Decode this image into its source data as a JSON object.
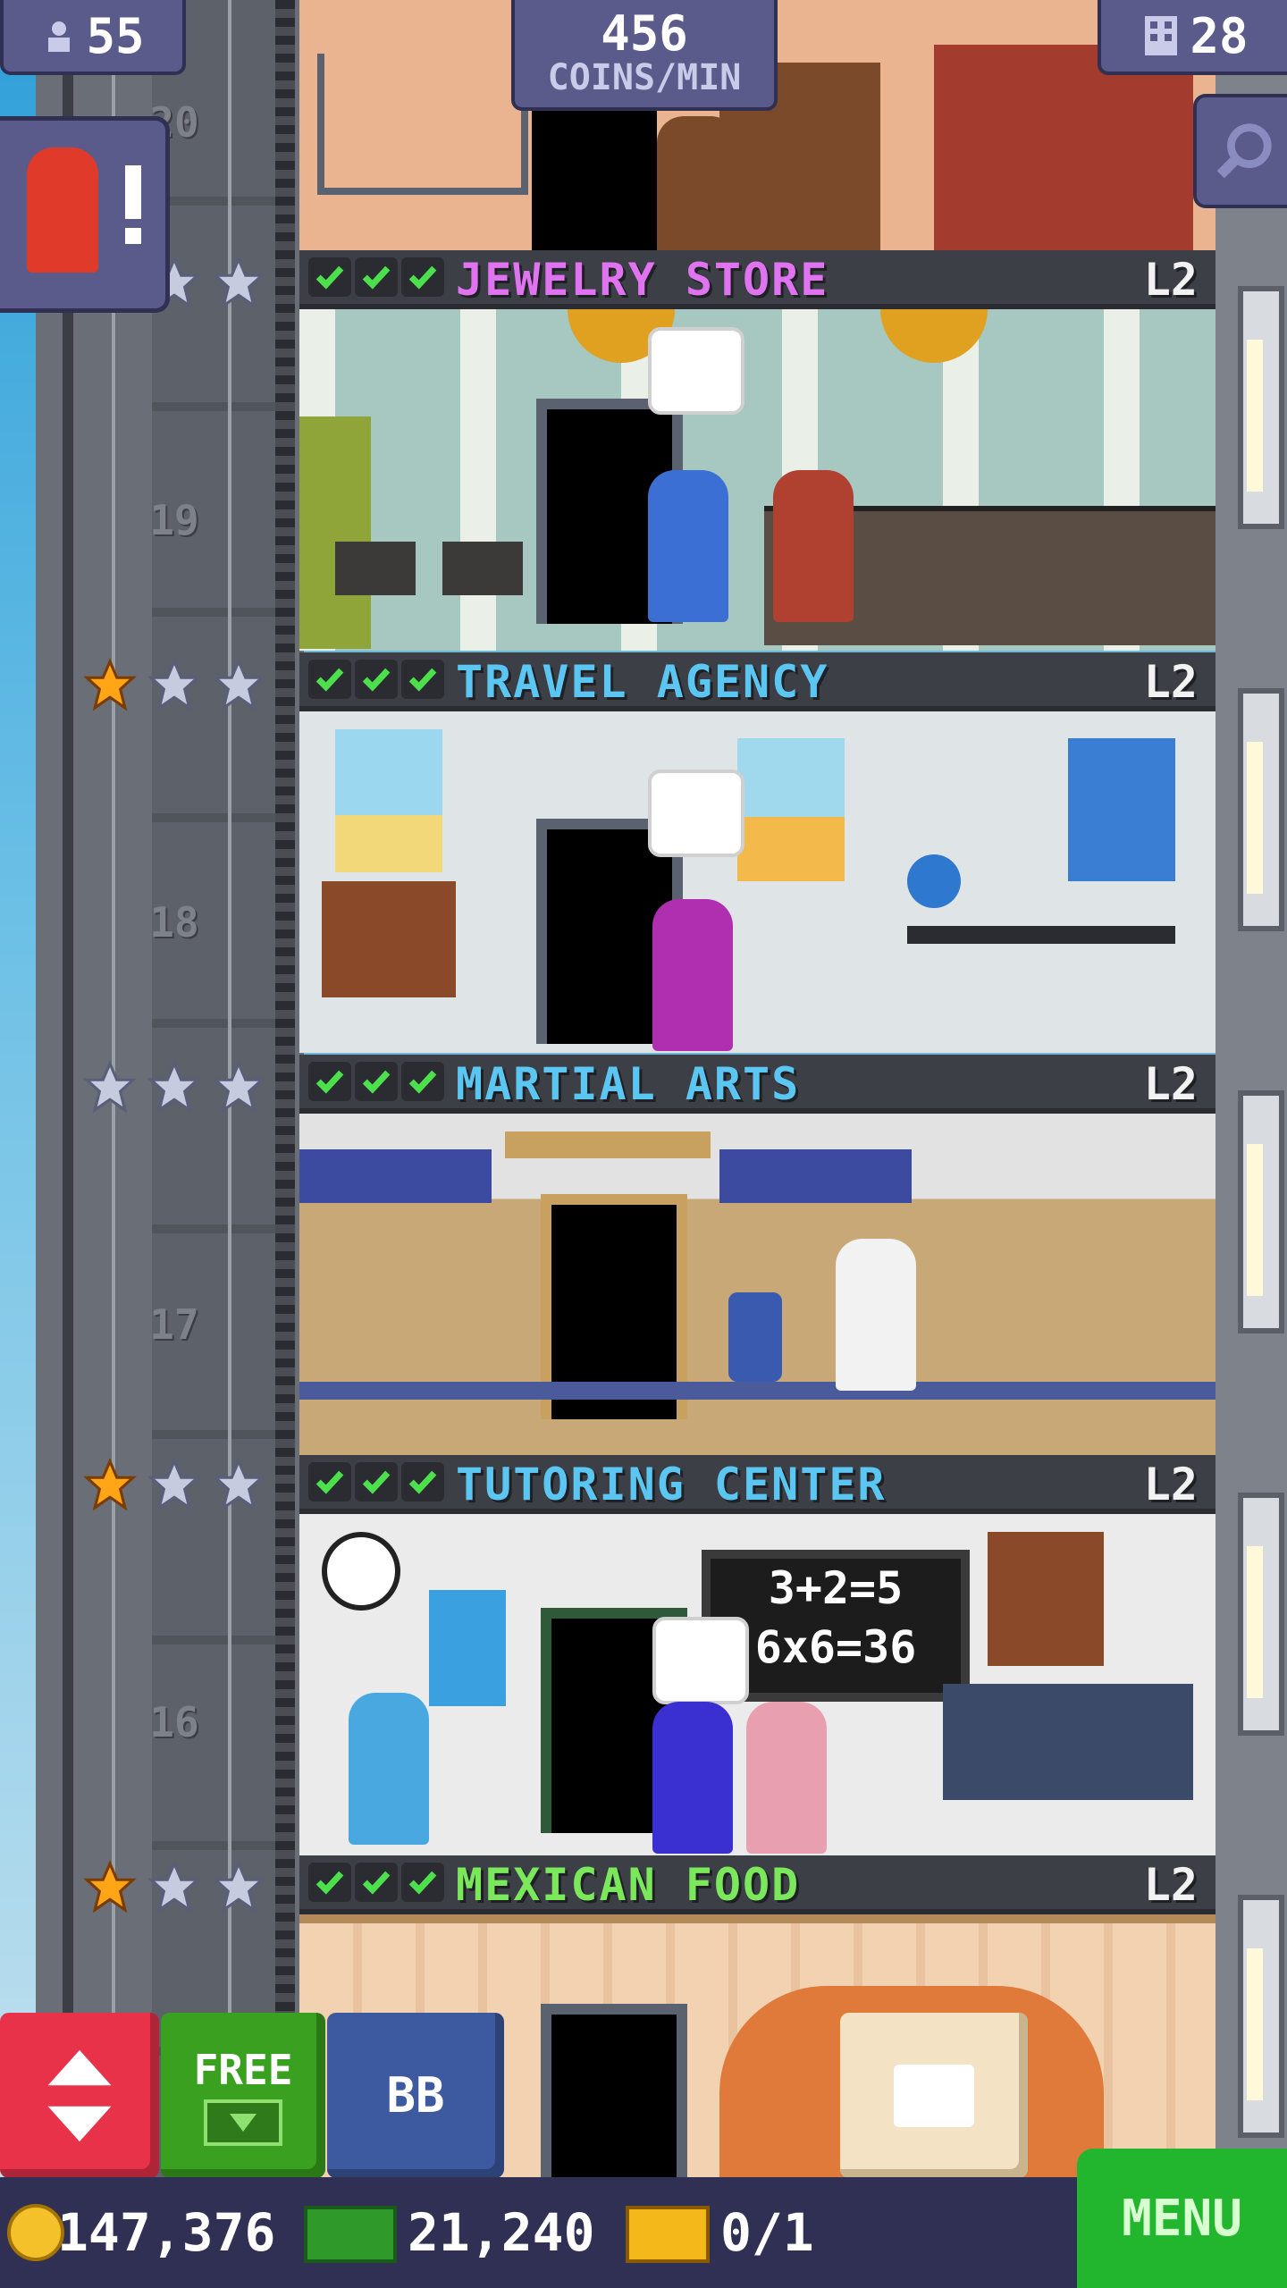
{
  "hud": {
    "residents": "55",
    "coins_per_min_value": "456",
    "coins_per_min_label": "COINS/MIN",
    "floors": "28"
  },
  "floors": [
    {
      "floor_number": "20",
      "name": "",
      "level": ""
    },
    {
      "floor_number": "19",
      "name": "JEWELRY STORE",
      "level": "L2",
      "name_color": "#e074f0",
      "stars_filled": 1
    },
    {
      "floor_number": "18",
      "name": "TRAVEL AGENCY",
      "level": "L2",
      "name_color": "#5cc6f2",
      "stars_filled": 1
    },
    {
      "floor_number": "17",
      "name": "MARTIAL ARTS",
      "level": "L2",
      "name_color": "#5cc6f2",
      "stars_filled": 0
    },
    {
      "floor_number": "16",
      "name": "TUTORING CENTER",
      "level": "L2",
      "name_color": "#5cc6f2",
      "stars_filled": 1
    },
    {
      "floor_number": "",
      "name": "MEXICAN FOOD",
      "level": "L2",
      "name_color": "#7be85c",
      "stars_filled": 1
    }
  ],
  "blackboard": {
    "line1": "3+2=5",
    "line2": "6x6=36"
  },
  "buttons": {
    "free": "FREE",
    "bb": "BB",
    "menu": "MENU"
  },
  "currency": {
    "coins": "147,376",
    "bux": "21,240",
    "tickets": "0/1"
  },
  "colors": {
    "elevator_red": "#e8324a",
    "free_green": "#3aa01f",
    "bb_blue": "#3d5aa0",
    "menu_green": "#22b52e",
    "star_gold": "#ffa516",
    "star_silver": "#c7cbe0"
  }
}
